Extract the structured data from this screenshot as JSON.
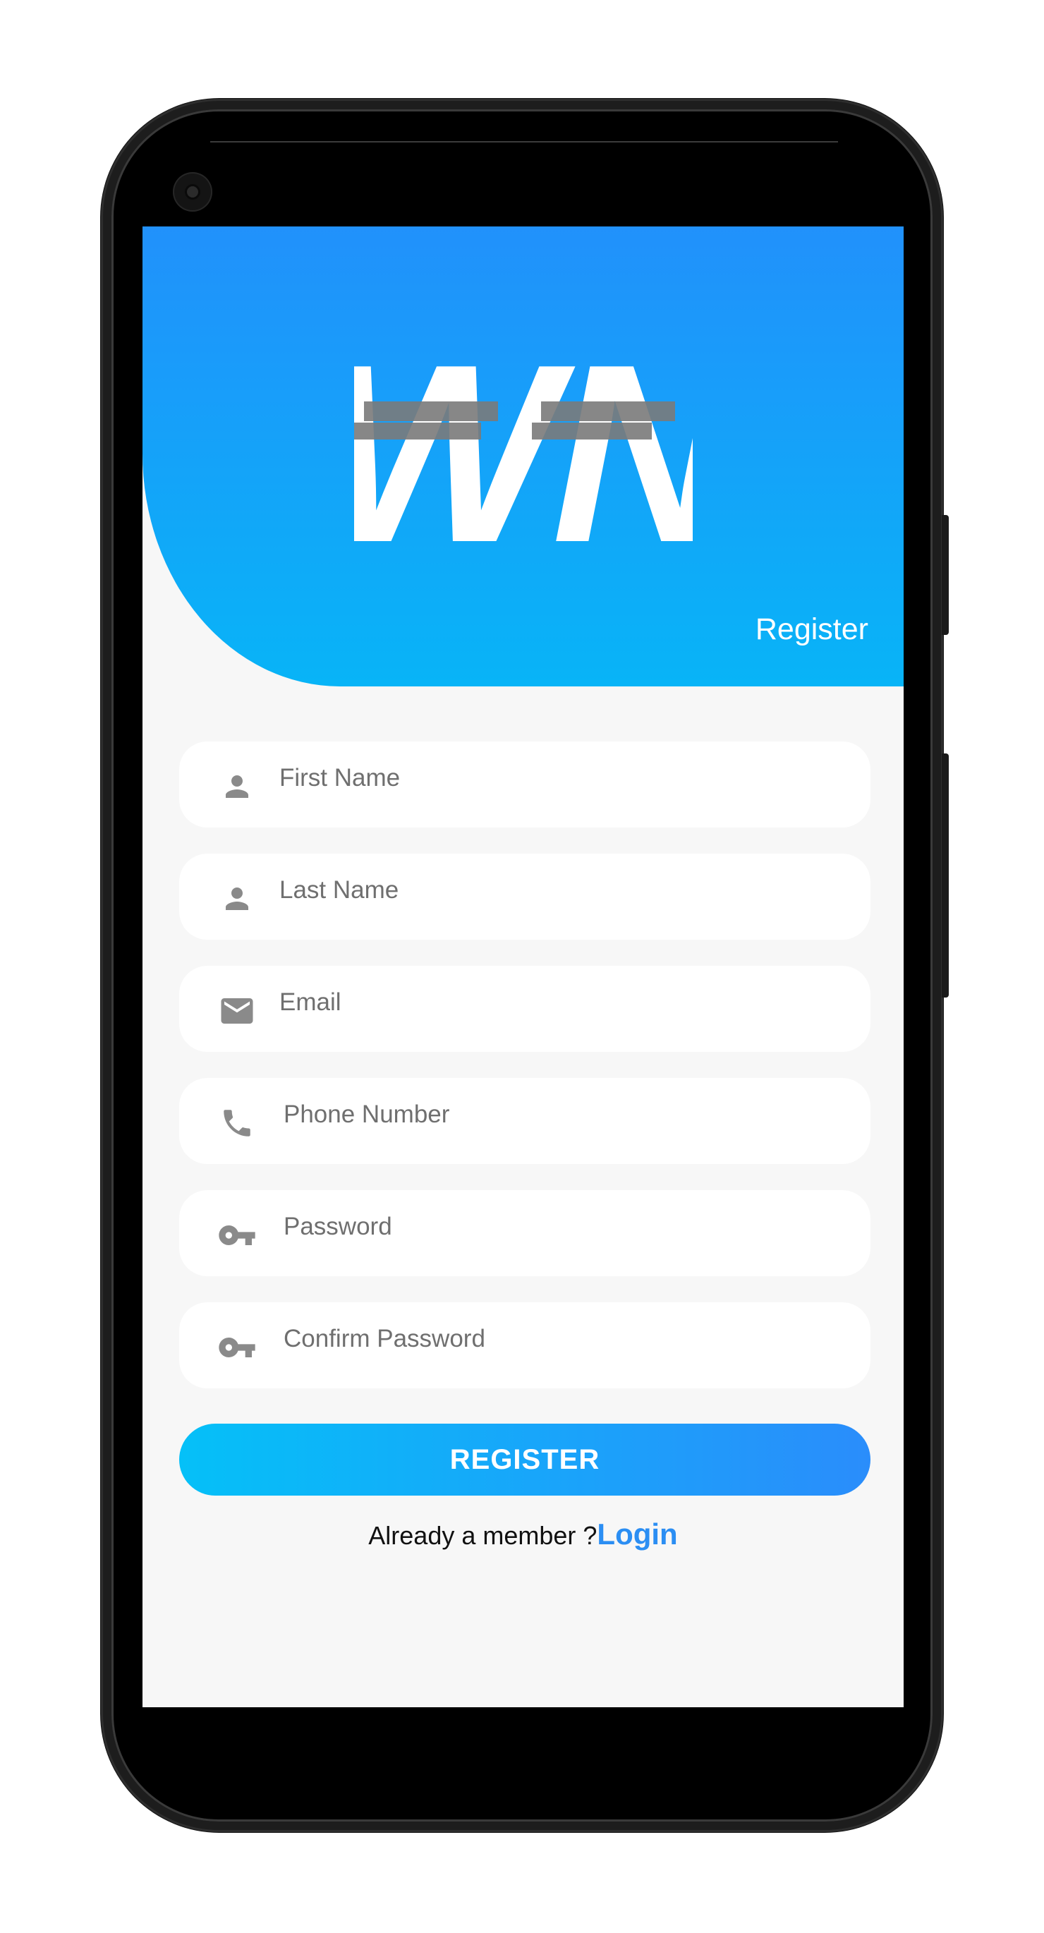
{
  "header": {
    "logo_text": "WN",
    "title": "Register"
  },
  "form": {
    "fields": [
      {
        "placeholder": "First Name",
        "icon": "person-icon"
      },
      {
        "placeholder": "Last Name",
        "icon": "person-icon"
      },
      {
        "placeholder": "Email",
        "icon": "mail-icon"
      },
      {
        "placeholder": "Phone Number",
        "icon": "phone-icon"
      },
      {
        "placeholder": "Password",
        "icon": "key-icon"
      },
      {
        "placeholder": "Confirm Password",
        "icon": "key-icon"
      }
    ],
    "submit_label": "REGISTER"
  },
  "footer": {
    "prompt": "Already a member ?",
    "link": "Login"
  },
  "colors": {
    "header_top": "#2191fb",
    "header_bottom": "#08b4f7",
    "button_start": "#05c0f8",
    "button_end": "#2a8dfb",
    "link": "#2b8ef3",
    "icon": "#8a8a8a"
  }
}
